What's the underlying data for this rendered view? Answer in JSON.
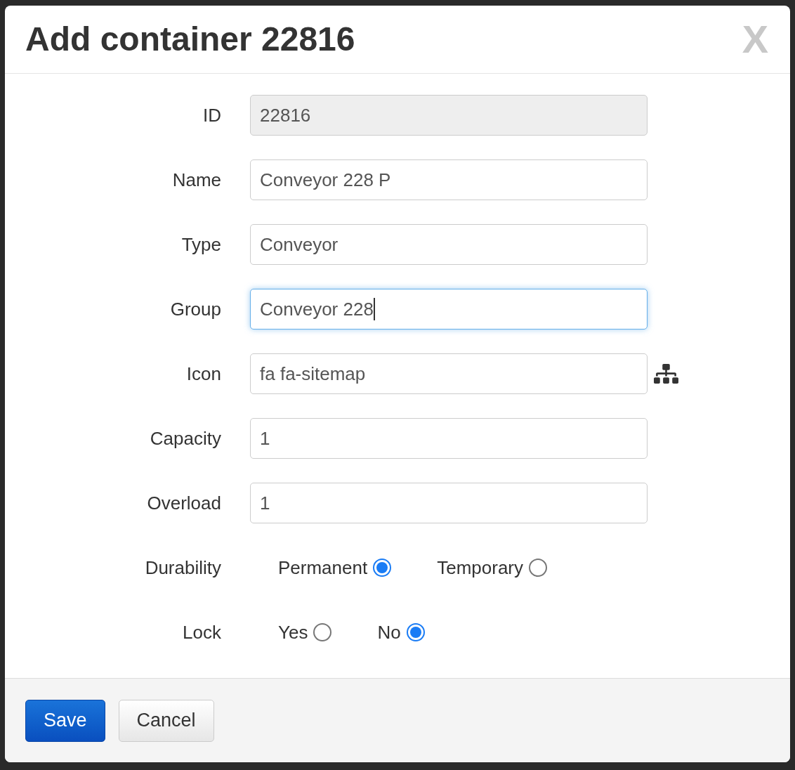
{
  "dialog": {
    "title": "Add container 22816",
    "close": "X"
  },
  "fields": [
    {
      "kind": "text",
      "label": "ID",
      "value": "22816",
      "disabled": true,
      "focused": false
    },
    {
      "kind": "text",
      "label": "Name",
      "value": "Conveyor 228 P",
      "disabled": false,
      "focused": false
    },
    {
      "kind": "text",
      "label": "Type",
      "value": "Conveyor",
      "disabled": false,
      "focused": false
    },
    {
      "kind": "text",
      "label": "Group",
      "value": "Conveyor 228",
      "disabled": false,
      "focused": true
    },
    {
      "kind": "icon_text",
      "label": "Icon",
      "value": "fa fa-sitemap",
      "disabled": false,
      "focused": false
    },
    {
      "kind": "text",
      "label": "Capacity",
      "value": "1",
      "disabled": false,
      "focused": false
    },
    {
      "kind": "text",
      "label": "Overload",
      "value": "1",
      "disabled": false,
      "focused": false
    },
    {
      "kind": "radio",
      "label": "Durability",
      "options": [
        {
          "label": "Permanent",
          "selected": true
        },
        {
          "label": "Temporary",
          "selected": false
        }
      ]
    },
    {
      "kind": "radio",
      "label": "Lock",
      "options": [
        {
          "label": "Yes",
          "selected": false
        },
        {
          "label": "No",
          "selected": true
        }
      ]
    }
  ],
  "buttons": [
    {
      "kind": "primary",
      "label": "Save"
    },
    {
      "kind": "default",
      "label": "Cancel"
    }
  ]
}
